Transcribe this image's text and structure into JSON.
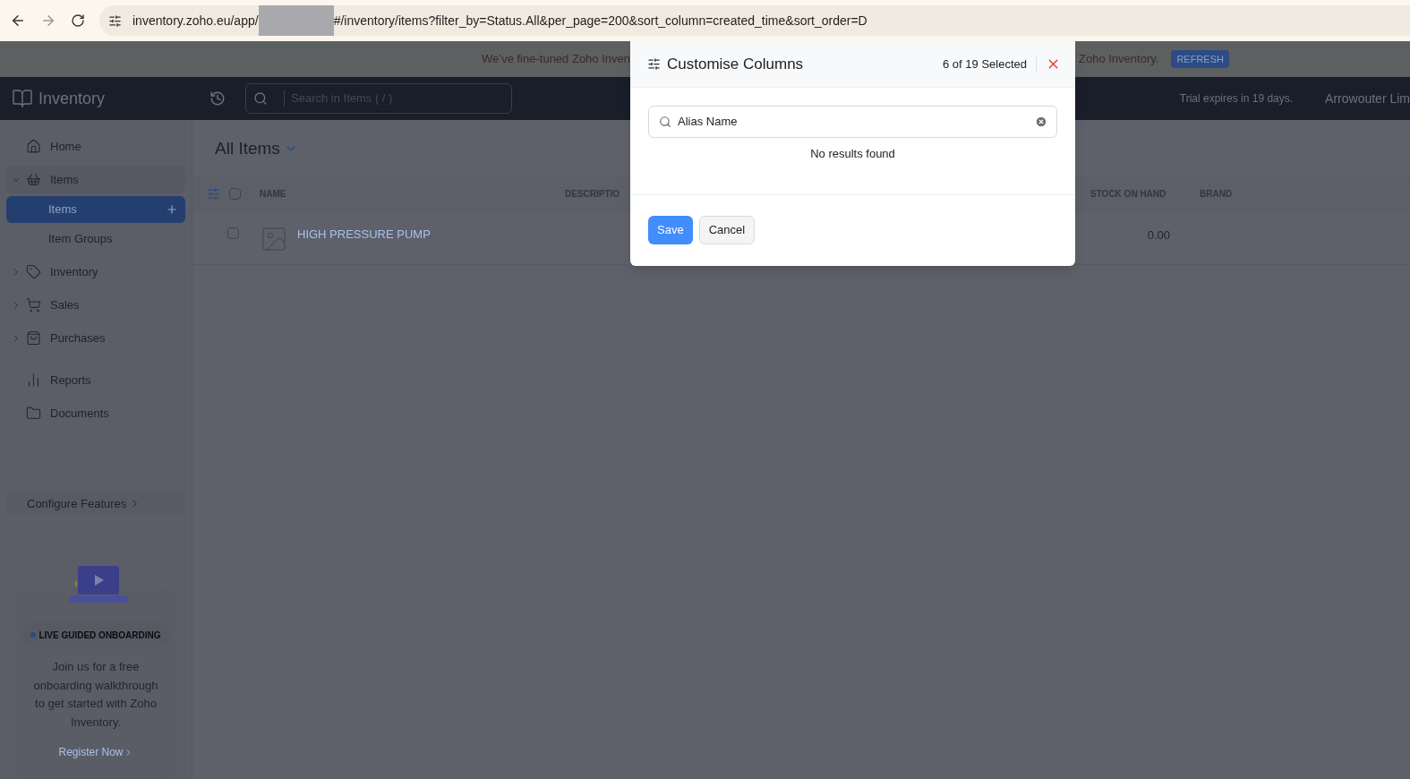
{
  "browser": {
    "url_start": "inventory.zoho.eu/app/",
    "url_end": "#/inventory/items?filter_by=Status.All&per_page=200&sort_column=created_time&sort_order=D"
  },
  "banner": {
    "text_start": "We’ve fine-tuned Zoho Inven",
    "text_end": "Zoho Inventory.",
    "button": "REFRESH"
  },
  "header": {
    "app_name": "Inventory",
    "search_placeholder": "Search in Items ( / )",
    "trial": "Trial expires in 19 days.",
    "org": "Arrowouter Lim"
  },
  "sidebar": {
    "sections": [
      [
        {
          "label": "Home"
        },
        {
          "label": "Items",
          "expanded": true,
          "children": [
            {
              "label": "Items",
              "selected": true,
              "add_button": true
            },
            {
              "label": "Item Groups",
              "selected": false,
              "add_button": false
            }
          ]
        },
        {
          "label": "Inventory",
          "expanded": false
        },
        {
          "label": "Sales",
          "expanded": false
        },
        {
          "label": "Purchases",
          "expanded": false
        }
      ],
      [
        {
          "label": "Reports"
        },
        {
          "label": "Documents"
        }
      ]
    ],
    "configure": "Configure Features",
    "onboarding": {
      "badge": "LIVE GUIDED ONBOARDING",
      "text": "Join us for a free onboarding walkthrough to get started with Zoho Inventory.",
      "link": "Register Now"
    }
  },
  "page": {
    "title": "All Items",
    "select_all_checked": false,
    "columns": [
      "NAME",
      "DESCRIPTIO",
      "STOCK ON HAND",
      "BRAND"
    ],
    "rows": [
      {
        "checked": false,
        "name": "HIGH PRESSURE PUMP",
        "stock": "0.00"
      }
    ]
  },
  "dialog": {
    "title": "Customise Columns",
    "count": "6 of 19 Selected",
    "search_value": "Alias Name",
    "empty": "No results found",
    "buttons": [
      "Save",
      "Cancel"
    ]
  }
}
